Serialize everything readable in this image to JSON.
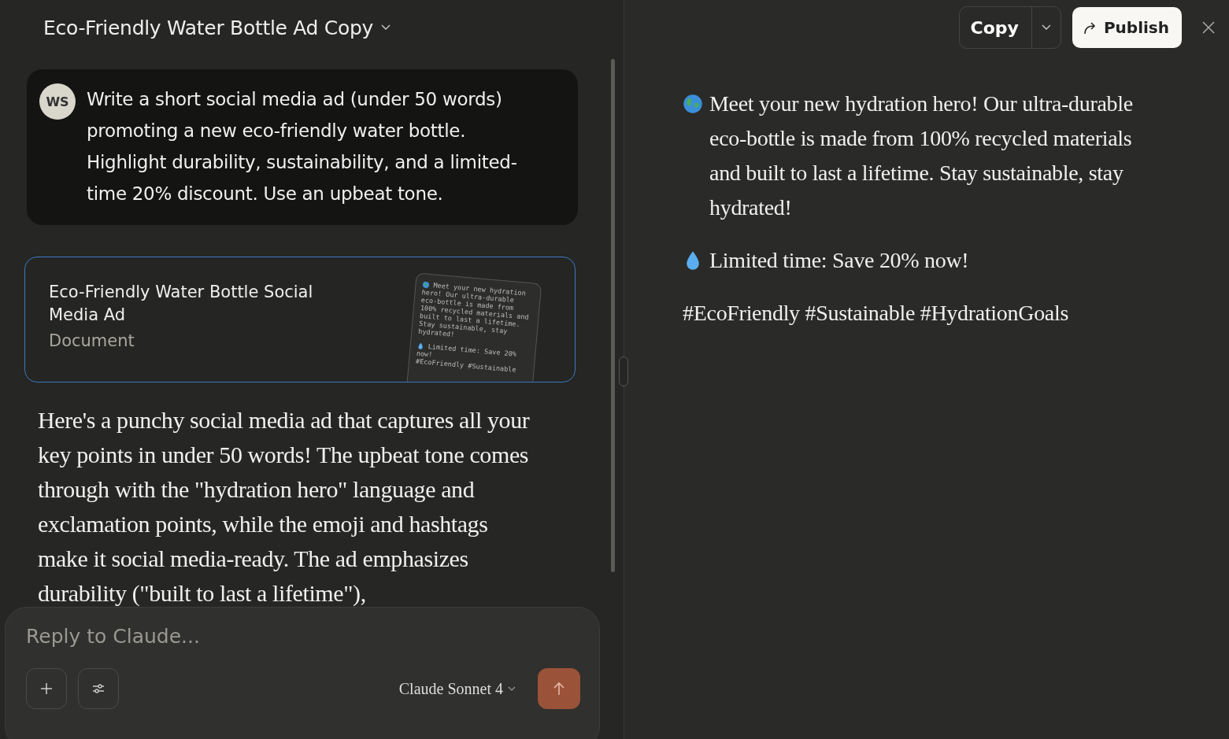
{
  "chat": {
    "title": "Eco-Friendly Water Bottle Ad Copy",
    "user_message": {
      "avatar": "WS",
      "text": "Write a short social media ad (under 50 words) promoting a new eco-friendly water bottle. Highlight durability, sustainability, and a limited-time 20% discount. Use an upbeat tone."
    },
    "artifact_card": {
      "title": "Eco-Friendly Water Bottle Social Media Ad",
      "type": "Document",
      "selected": true,
      "preview_lines": [
        {
          "kind": "globe",
          "text": "Meet your new hydration"
        },
        {
          "kind": "plain",
          "text": "hero! Our ultra-durable"
        },
        {
          "kind": "plain",
          "text": "eco-bottle is made from"
        },
        {
          "kind": "plain",
          "text": "100% recycled materials and"
        },
        {
          "kind": "plain",
          "text": "built to last a lifetime."
        },
        {
          "kind": "plain",
          "text": "Stay sustainable, stay"
        },
        {
          "kind": "plain",
          "text": "hydrated!"
        },
        {
          "kind": "drop",
          "text": "Limited time: Save 20%"
        },
        {
          "kind": "plain",
          "text": "now!"
        },
        {
          "kind": "plain",
          "text": "#EcoFriendly #Sustainable"
        }
      ]
    },
    "response": "Here's a punchy social media ad that captures all your key points in under 50 words! The upbeat tone comes through with the \"hydration hero\" language and exclamation points, while the emoji and hashtags make it social media-ready. The ad emphasizes durability (\"built to last a lifetime\"),",
    "composer": {
      "placeholder": "Reply to Claude...",
      "model": "Claude Sonnet 4"
    }
  },
  "document": {
    "copy_button": "Copy",
    "publish_button": "Publish",
    "paragraphs": [
      {
        "kind": "globe",
        "text": "Meet your new hydration hero! Our ultra-durable eco-bottle is made from 100% recycled materials and built to last a lifetime. Stay sustainable, stay hydrated!"
      },
      {
        "kind": "drop",
        "text": "Limited time: Save 20% now!"
      },
      {
        "kind": "plain",
        "text": "#EcoFriendly #Sustainable #HydrationGoals"
      }
    ]
  }
}
